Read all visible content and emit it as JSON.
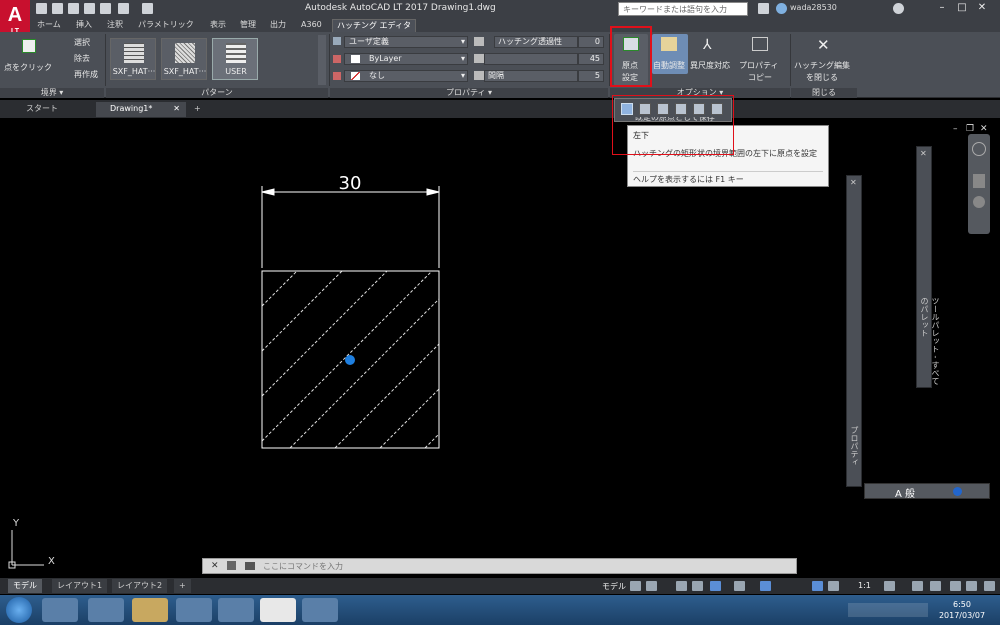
{
  "app": {
    "logo": "A",
    "logo_sub": "LT",
    "title": "Autodesk AutoCAD LT 2017    Drawing1.dwg",
    "search_placeholder": "キーワードまたは語句を入力",
    "user": "wada28530"
  },
  "ribbon_tabs": [
    "ホーム",
    "挿入",
    "注釈",
    "パラメトリック",
    "表示",
    "管理",
    "出力",
    "A360",
    "ハッチング エディタ"
  ],
  "active_tab": "ハッチング エディタ",
  "ribbon": {
    "boundary": {
      "pick_point": "点をクリック",
      "select": "選択",
      "remove": "除去",
      "recreate": "再作成",
      "panel_title": "境界 ▾"
    },
    "pattern": {
      "tiles": [
        "SXF_HAT···",
        "SXF_HAT···",
        "USER"
      ],
      "selected": "USER",
      "panel_title": "パターン"
    },
    "properties": {
      "hatch_type": "ユーザ定義",
      "color": "ByLayer",
      "background": "なし",
      "transparency_label": "ハッチング透過性",
      "transparency_value": "0",
      "angle_value": "45",
      "spacing_label": "間隔",
      "spacing_value": "5",
      "panel_title": "プロパティ ▾"
    },
    "origin": {
      "set_origin_line1": "原点",
      "set_origin_line2": "設定",
      "associative": "自動調整",
      "annotative": "異尺度対応",
      "match_line1": "プロパティ",
      "match_line2": "コピー",
      "panel_title": "オプション ▾"
    },
    "close": {
      "label_line1": "ハッチング編集",
      "label_line2": "を閉じる",
      "panel_title": "閉じる"
    }
  },
  "flyout": {
    "store_default": "既定の原点として保存"
  },
  "tooltip": {
    "title": "左下",
    "description": "ハッチングの矩形状の境界範囲の左下に原点を設定",
    "help": "ヘルプを表示するには F1 キー"
  },
  "doc_tabs": [
    "スタート",
    "Drawing1*"
  ],
  "drawing": {
    "dimension_text": "30",
    "ucs_x": "X",
    "ucs_y": "Y"
  },
  "palettes": {
    "properties_title": "プロパティ",
    "tool_palette_title": "ツールパレット - すべてのパレット",
    "ime_text": "A 般"
  },
  "command_line": {
    "placeholder": "ここにコマンドを入力"
  },
  "layout_tabs": [
    "モデル",
    "レイアウト1",
    "レイアウト2"
  ],
  "status": {
    "model": "モデル",
    "scale": "1:1"
  },
  "taskbar": {
    "time": "6:50",
    "date": "2017/03/07"
  },
  "colors": {
    "accent_red": "#e0101a",
    "grip_blue": "#1e7fe0",
    "logo_red": "#c8102e"
  }
}
